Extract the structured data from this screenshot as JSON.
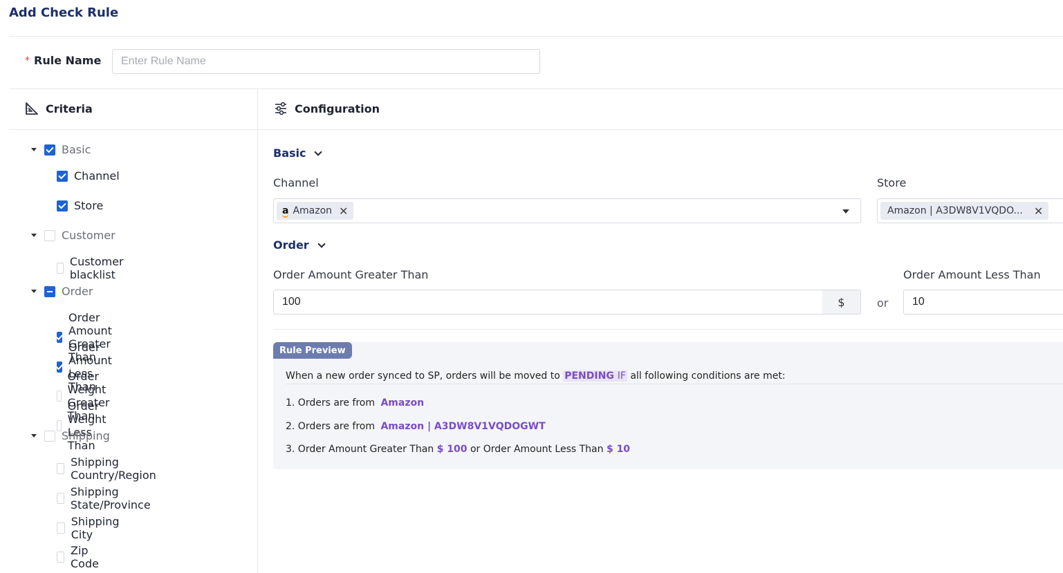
{
  "page": {
    "title": "Add Check Rule"
  },
  "rule_name": {
    "label": "Rule Name",
    "required_mark": "*",
    "placeholder": "Enter Rule Name",
    "value": ""
  },
  "criteria": {
    "title": "Criteria",
    "groups": [
      {
        "label": "Basic",
        "state": "checked",
        "items": [
          {
            "label": "Channel",
            "checked": true
          },
          {
            "label": "Store",
            "checked": true
          }
        ]
      },
      {
        "label": "Customer",
        "state": "unchecked",
        "items": [
          {
            "label": "Customer blacklist",
            "checked": false
          }
        ]
      },
      {
        "label": "Order",
        "state": "partial",
        "items": [
          {
            "label": "Order Amount Greater Than",
            "checked": true
          },
          {
            "label": "Order Amount Less Than",
            "checked": true
          },
          {
            "label": "Order Weight Greater Than",
            "checked": false
          },
          {
            "label": "Order Weight Less Than",
            "checked": false
          }
        ]
      },
      {
        "label": "Shipping",
        "state": "unchecked",
        "items": [
          {
            "label": "Shipping Country/Region",
            "checked": false
          },
          {
            "label": "Shipping State/Province",
            "checked": false
          },
          {
            "label": "Shipping City",
            "checked": false
          },
          {
            "label": "Zip Code",
            "checked": false
          }
        ]
      }
    ]
  },
  "configuration": {
    "title": "Configuration",
    "basic": {
      "title": "Basic",
      "channel": {
        "label": "Channel",
        "tag": "Amazon",
        "tag_icon": "a"
      },
      "store": {
        "label": "Store",
        "tag": "Amazon | A3DW8V1VQDO..."
      }
    },
    "order": {
      "title": "Order",
      "greater": {
        "label": "Order Amount Greater Than",
        "value": "100",
        "unit": "$"
      },
      "or_text": "or",
      "less": {
        "label": "Order Amount Less Than",
        "value": "10"
      }
    }
  },
  "preview": {
    "badge": "Rule Preview",
    "intro_prefix": "When a new order synced to SP, orders will be moved to",
    "intro_status": "PENDING",
    "intro_if": "IF",
    "intro_suffix": "all following conditions are met:",
    "line1_prefix": "1. Orders are from",
    "line1_value": "Amazon",
    "line2_prefix": "2. Orders are from",
    "line2_value": "Amazon | A3DW8V1VQDOGWT",
    "line3_a": "3. Order Amount Greater Than",
    "line3_v1": "$ 100",
    "line3_b": "or Order Amount Less Than",
    "line3_v2": "$ 10"
  }
}
